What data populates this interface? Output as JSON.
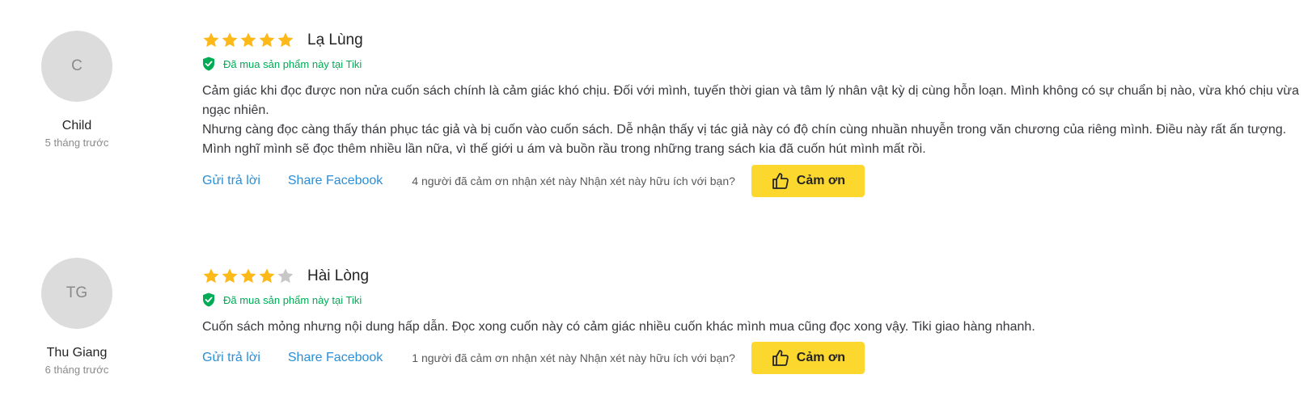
{
  "colors": {
    "star_filled": "#fdb91a",
    "star_empty": "#c7c7c7",
    "verified": "#00ab56",
    "link": "#2a8fd6",
    "thanks_button": "#fcd82e"
  },
  "reviews": [
    {
      "avatar_initials": "C",
      "user_name": "Child",
      "time_ago": "5 tháng trước",
      "rating": 5,
      "title": "Lạ Lùng",
      "verified_text": "Đã mua sản phẩm này tại Tiki",
      "paragraphs": [
        "Cảm giác khi đọc được non nửa cuốn sách chính là cảm giác khó chịu. Đối với mình, tuyến thời gian và tâm lý nhân vật kỳ dị cùng hỗn loạn. Mình không có sự chuẩn bị nào, vừa khó chịu vừa ngạc nhiên.",
        "Nhưng càng đọc càng thấy thán phục tác giả và bị cuốn vào cuốn sách. Dễ nhận thấy vị tác giả này có độ chín cùng nhuần nhuyễn trong văn chương của riêng mình. Điều này rất ấn tượng.",
        "Mình nghĩ mình sẽ đọc thêm nhiều lần nữa, vì thế giới u ám và buồn rầu trong những trang sách kia đã cuốn hút mình mất rồi."
      ],
      "reply_label": "Gửi trả lời",
      "share_label": "Share Facebook",
      "thanks_text": "4 người đã cảm ơn nhận xét này Nhận xét này hữu ích với bạn?",
      "thanks_button": "Cảm ơn"
    },
    {
      "avatar_initials": "TG",
      "user_name": "Thu Giang",
      "time_ago": "6 tháng trước",
      "rating": 4,
      "title": "Hài Lòng",
      "verified_text": "Đã mua sản phẩm này tại Tiki",
      "paragraphs": [
        "Cuốn sách mỏng nhưng nội dung hấp dẫn. Đọc xong cuốn này có cảm giác nhiều cuốn khác mình mua cũng đọc xong vậy. Tiki giao hàng nhanh."
      ],
      "reply_label": "Gửi trả lời",
      "share_label": "Share Facebook",
      "thanks_text": "1 người đã cảm ơn nhận xét này Nhận xét này hữu ích với bạn?",
      "thanks_button": "Cảm ơn"
    }
  ]
}
